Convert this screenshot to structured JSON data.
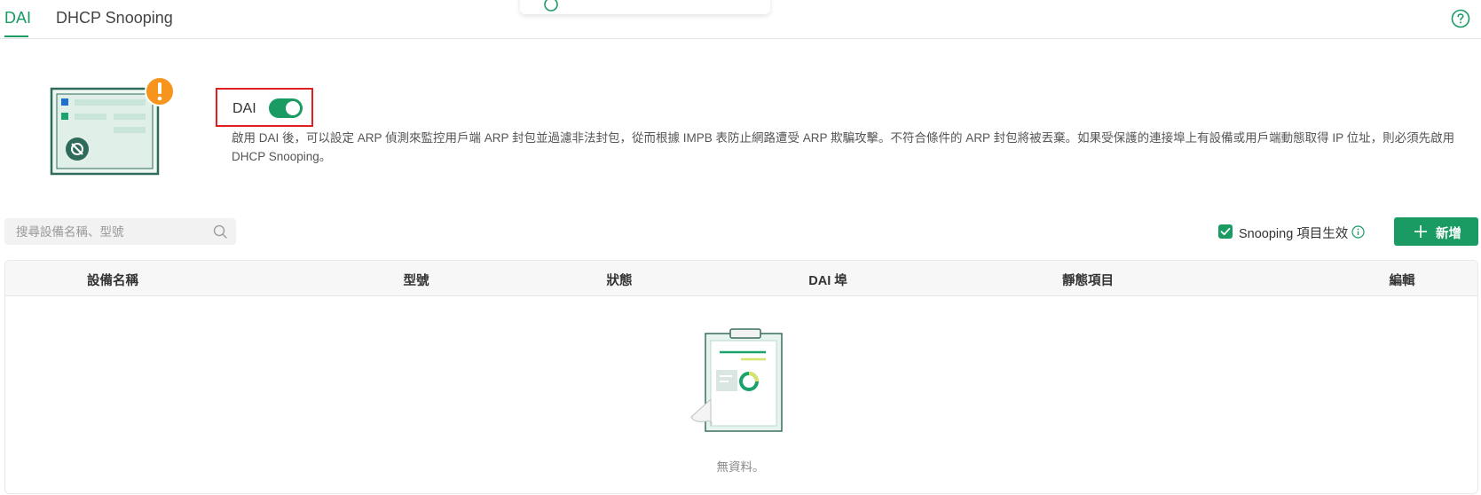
{
  "tabs": [
    {
      "label": "DAI",
      "active": true
    },
    {
      "label": "DHCP Snooping",
      "active": false
    }
  ],
  "dai": {
    "label": "DAI",
    "enabled": true,
    "description": "啟用 DAI 後，可以設定 ARP 偵測來監控用戶端 ARP 封包並過濾非法封包，從而根據 IMPB 表防止網路遭受 ARP 欺騙攻擊。不符合條件的 ARP 封包將被丟棄。如果受保護的連接埠上有設備或用戶端動態取得 IP 位址，則必須先啟用 DHCP Snooping。"
  },
  "search": {
    "placeholder": "搜尋設備名稱、型號",
    "value": ""
  },
  "snooping": {
    "label": "Snooping 項目生效",
    "checked": true
  },
  "add_button": {
    "label": "新增"
  },
  "table": {
    "columns": [
      "設備名稱",
      "型號",
      "狀態",
      "DAI 埠",
      "靜態項目",
      "編輯"
    ],
    "rows": [],
    "empty_text": "無資料。"
  },
  "colors": {
    "accent": "#1a9b63",
    "warning": "#f7941d",
    "highlight_border": "#e02020"
  },
  "icons": {
    "help": "question-circle-icon",
    "search": "magnifier-icon",
    "info": "info-circle-icon",
    "add": "plus-icon",
    "warning": "exclamation-badge-icon"
  }
}
